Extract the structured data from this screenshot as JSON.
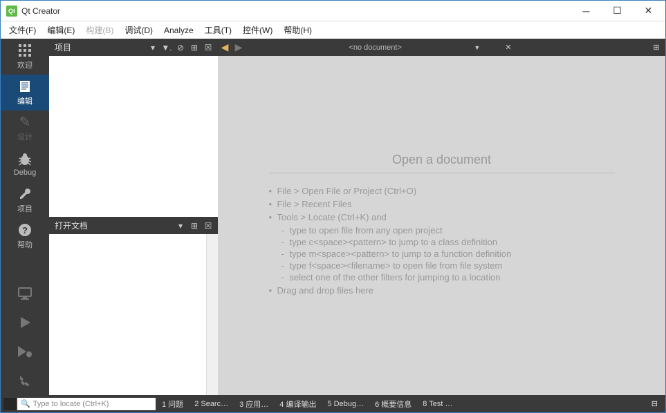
{
  "window": {
    "title": "Qt Creator"
  },
  "menu": {
    "file": "文件(F)",
    "edit": "编辑(E)",
    "build": "构建(B)",
    "debug": "调试(D)",
    "analyze": "Analyze",
    "tools": "工具(T)",
    "widgets": "控件(W)",
    "help": "帮助(H)"
  },
  "modes": {
    "welcome": "欢迎",
    "edit": "编辑",
    "design": "设计",
    "debug": "Debug",
    "project": "项目",
    "help": "帮助"
  },
  "panels": {
    "projects": "项目",
    "openDocs": "打开文档"
  },
  "editor": {
    "noDoc": "<no document>",
    "hint": {
      "title": "Open a document",
      "l1": "File > Open File or Project (Ctrl+O)",
      "l2": "File > Recent Files",
      "l3": "Tools > Locate (Ctrl+K) and",
      "l3a": "type to open file from any open project",
      "l3b": "type c<space><pattern> to jump to a class definition",
      "l3c": "type m<space><pattern> to jump to a function definition",
      "l3d": "type f<space><filename> to open file from file system",
      "l3e": "select one of the other filters for jumping to a location",
      "l4": "Drag and drop files here"
    }
  },
  "status": {
    "locatePlaceholder": "Type to locate (Ctrl+K)",
    "i1": "1 问题",
    "i2": "2 Searc…",
    "i3": "3 应用…",
    "i4": "4 编译输出",
    "i5": "5 Debug…",
    "i6": "6 概要信息",
    "i7": "8 Test …"
  }
}
